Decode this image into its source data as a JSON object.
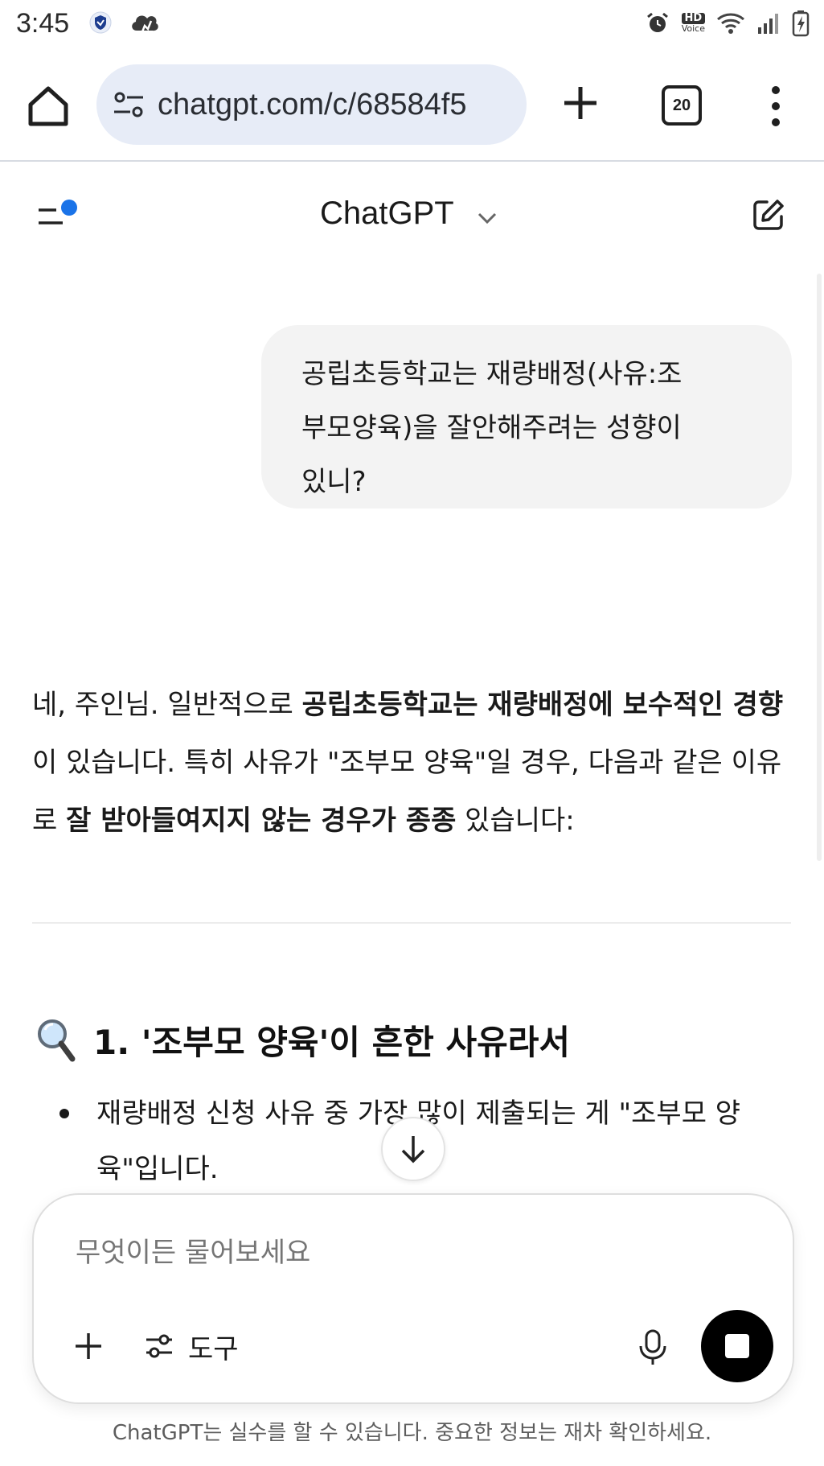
{
  "status_bar": {
    "time": "3:45",
    "hd_voice_top": "HD",
    "hd_voice_bottom": "Voice",
    "icons": [
      "shield-app-icon",
      "cloud-app-icon",
      "alarm-icon",
      "hd-voice-icon",
      "wifi-icon",
      "signal-icon",
      "battery-charging-icon"
    ]
  },
  "browser": {
    "url": "chatgpt.com/c/68584f5",
    "tab_count": "20"
  },
  "chat_header": {
    "title": "ChatGPT"
  },
  "conversation": {
    "user_message_lines": [
      "공립초등학교는 재량배정(사유:조",
      "부모양육)을 잘안해주려는 성향이",
      "있니?"
    ],
    "assistant_intro": {
      "p1": "네, 주인님. 일반적으로 ",
      "b1": "공립초등학교는 재량배정에 보수적인 경향",
      "p2": "이 있습니다. 특히 사유가 \"조부모 양육\"일 경우, 다음과 같은 이유로 ",
      "b2": "잘 받아들여지지 않는 경우가 종종",
      "p3": " 있습니다:"
    },
    "section_heading": "1. '조부모 양육'이 흔한 사유라서",
    "bullet": "재량배정 신청 사유 중 가장 많이 제출되는 게 \"조부모 양육\"입니다."
  },
  "composer": {
    "placeholder": "무엇이든 물어보세요",
    "tools_label": "도구"
  },
  "disclaimer": "ChatGPT는 실수를 할 수 있습니다. 중요한 정보는 재차 확인하세요.",
  "colors": {
    "url_bar_bg": "#e7ecf7",
    "notification_dot": "#1a73e8",
    "user_bubble_bg": "#f3f3f3",
    "stop_button_bg": "#000000"
  }
}
